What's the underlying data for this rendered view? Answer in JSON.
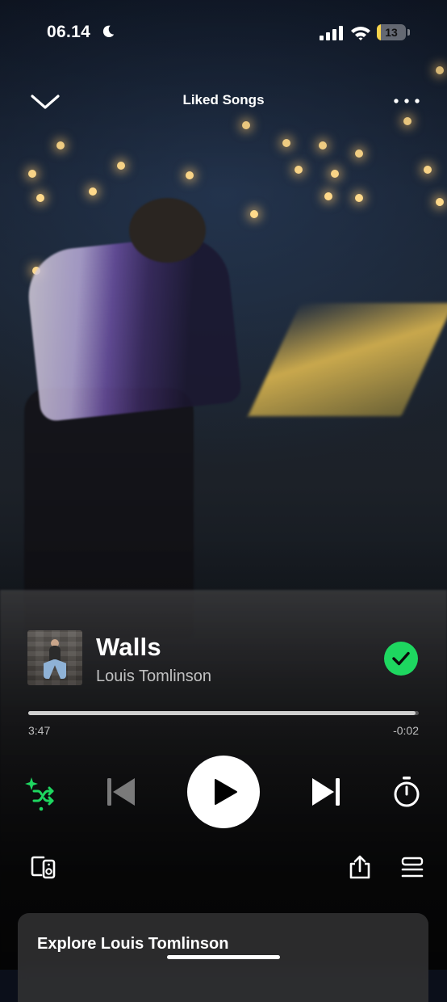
{
  "status_bar": {
    "time": "06.14",
    "battery_level": "13",
    "battery_fraction": 0.13,
    "icons": [
      "moon-icon",
      "cellular-signal-icon",
      "wifi-icon",
      "battery-icon"
    ]
  },
  "header": {
    "title": "Liked Songs",
    "left_icon": "chevron-down-icon",
    "right_icon": "more-icon"
  },
  "track": {
    "title": "Walls",
    "artist": "Louis Tomlinson",
    "liked": true
  },
  "playback": {
    "elapsed": "3:47",
    "remaining": "-0:02",
    "progress_fraction": 0.991
  },
  "controls": {
    "shuffle_icon": "smart-shuffle-icon",
    "previous_icon": "skip-previous-icon",
    "play_icon": "play-icon",
    "next_icon": "skip-next-icon",
    "timer_icon": "sleep-timer-icon"
  },
  "actions": {
    "devices_icon": "connect-devices-icon",
    "share_icon": "share-icon",
    "queue_icon": "queue-icon"
  },
  "explore": {
    "label": "Explore Louis Tomlinson"
  },
  "colors": {
    "accent": "#1ed760",
    "battery": "#f7d24a"
  }
}
